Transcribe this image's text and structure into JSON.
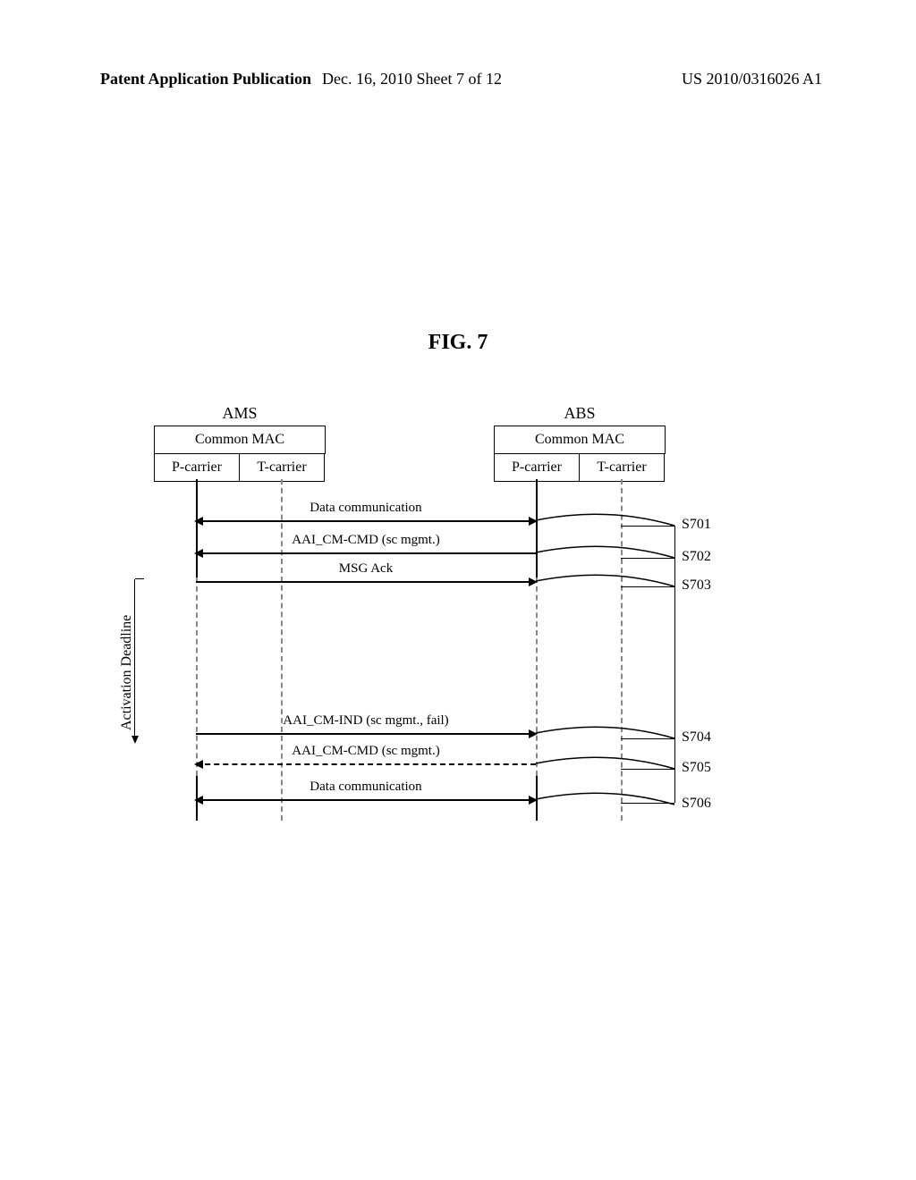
{
  "header": {
    "left": "Patent Application Publication",
    "center": "Dec. 16, 2010  Sheet 7 of 12",
    "right": "US 2010/0316026 A1"
  },
  "figure": {
    "title": "FIG. 7"
  },
  "entities": {
    "ams": {
      "title": "AMS",
      "mac": "Common MAC",
      "p_carrier": "P-carrier",
      "t_carrier": "T-carrier"
    },
    "abs": {
      "title": "ABS",
      "mac": "Common MAC",
      "p_carrier": "P-carrier",
      "t_carrier": "T-carrier"
    }
  },
  "deadline_label": "Activation Deadline",
  "messages": {
    "m1": "Data communication",
    "m2": "AAI_CM-CMD (sc mgmt.)",
    "m3": "MSG Ack",
    "m4": "AAI_CM-IND (sc mgmt., fail)",
    "m5": "AAI_CM-CMD (sc mgmt.)",
    "m6": "Data communication"
  },
  "steps": {
    "s1": "S701",
    "s2": "S702",
    "s3": "S703",
    "s4": "S704",
    "s5": "S705",
    "s6": "S706"
  }
}
